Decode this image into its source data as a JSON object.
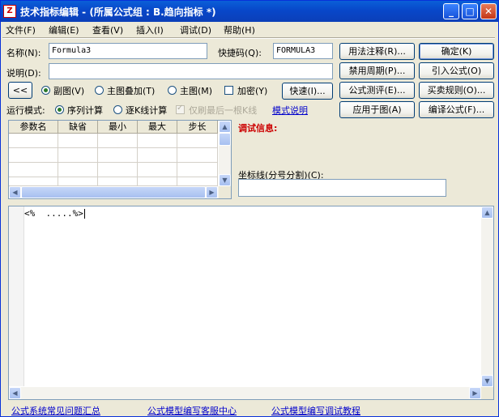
{
  "window": {
    "title": "技术指标编辑 - (所属公式组 : B.趋向指标 *)",
    "app_icon": "Z",
    "minimize_icon": "_",
    "maximize_icon": "□",
    "close_icon": "✕"
  },
  "menu": [
    {
      "label": "文件(F)"
    },
    {
      "label": "编辑(E)"
    },
    {
      "label": "查看(V)"
    },
    {
      "label": "插入(I)"
    },
    {
      "label": "调试(D)"
    },
    {
      "label": "帮助(H)"
    }
  ],
  "form": {
    "name_label": "名称(N):",
    "name_value": "Formula3",
    "shortcut_label": "快捷码(Q):",
    "shortcut_value": "FORMULA3",
    "desc_label": "说明(D):",
    "desc_value": "",
    "collapse_label": "<<",
    "chart_options": [
      {
        "label": "副图(V)",
        "selected": true
      },
      {
        "label": "主图叠加(T)",
        "selected": false
      },
      {
        "label": "主图(M)",
        "selected": false
      }
    ],
    "encrypt_label": "加密(Y)",
    "quick_label": "快速(I)...",
    "run_mode_label": "运行模式:",
    "run_modes": [
      {
        "label": "序列计算",
        "selected": true
      },
      {
        "label": "逐K线计算",
        "selected": false
      }
    ],
    "last_bar_label": "仅刷最后一根K线",
    "mode_help_link": "模式说明"
  },
  "buttons": {
    "usage_notes": "用法注释(R)...",
    "confirm": "确定(K)",
    "disable_period": "禁用周期(P)...",
    "import_formula": "引入公式(O)",
    "formula_test": "公式测评(E)...",
    "trade_rules": "买卖规则(O)...",
    "apply_to_chart": "应用于图(A)",
    "compile": "编译公式(F)..."
  },
  "params_table": {
    "columns": [
      "参数名",
      "缺省",
      "最小",
      "最大",
      "步长"
    ]
  },
  "debug": {
    "label": "调试信息:",
    "coord_label": "坐标线(分号分割)(C):",
    "coord_value": ""
  },
  "editor": {
    "code": "<%  .....%>"
  },
  "footer_links": [
    "公式系统常见问题汇总",
    "公式模型编写客服中心",
    "公式模型编写调试教程"
  ],
  "scroll_icons": {
    "up": "▲",
    "down": "▼",
    "left": "◀",
    "right": "▶"
  }
}
